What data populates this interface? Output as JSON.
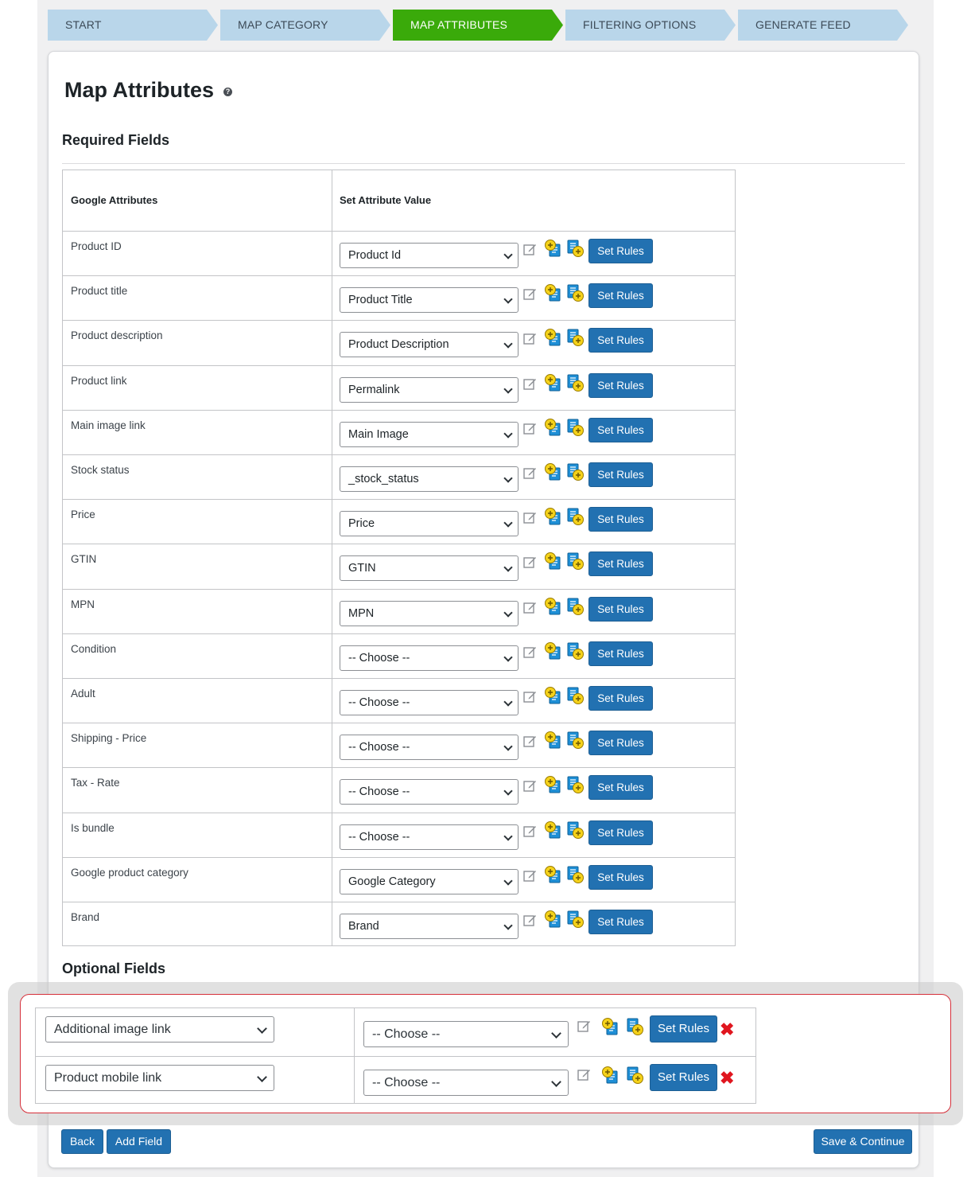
{
  "wizard": {
    "steps": [
      {
        "label": "START",
        "active": false
      },
      {
        "label": "MAP CATEGORY",
        "active": false
      },
      {
        "label": "MAP ATTRIBUTES",
        "active": true
      },
      {
        "label": "FILTERING OPTIONS",
        "active": false
      },
      {
        "label": "GENERATE FEED",
        "active": false
      }
    ]
  },
  "page": {
    "title": "Map Attributes",
    "help_icon": "question-icon"
  },
  "required": {
    "section_title": "Required Fields",
    "col_google": "Google Attributes",
    "col_value": "Set Attribute Value",
    "set_rules_label": "Set Rules",
    "rows": [
      {
        "attribute": "Product ID",
        "value": "Product Id"
      },
      {
        "attribute": "Product title",
        "value": "Product Title"
      },
      {
        "attribute": "Product description",
        "value": "Product Description"
      },
      {
        "attribute": "Product link",
        "value": "Permalink"
      },
      {
        "attribute": "Main image link",
        "value": "Main Image"
      },
      {
        "attribute": "Stock status",
        "value": "_stock_status"
      },
      {
        "attribute": "Price",
        "value": "Price"
      },
      {
        "attribute": "GTIN",
        "value": "GTIN"
      },
      {
        "attribute": "MPN",
        "value": "MPN"
      },
      {
        "attribute": "Condition",
        "value": "-- Choose --"
      },
      {
        "attribute": "Adult",
        "value": "-- Choose --"
      },
      {
        "attribute": "Shipping - Price",
        "value": "-- Choose --"
      },
      {
        "attribute": "Tax - Rate",
        "value": "-- Choose --"
      },
      {
        "attribute": "Is bundle",
        "value": "-- Choose --"
      },
      {
        "attribute": "Google product category",
        "value": "Google Category"
      },
      {
        "attribute": "Brand",
        "value": "Brand"
      }
    ]
  },
  "optional": {
    "section_title": "Optional Fields",
    "set_rules_label": "Set Rules",
    "rows": [
      {
        "attribute": "Additional image link",
        "value": "-- Choose --"
      },
      {
        "attribute": "Product mobile link",
        "value": "-- Choose --"
      }
    ]
  },
  "footer": {
    "back_label": "Back",
    "add_field_label": "Add Field",
    "save_label": "Save & Continue"
  },
  "colors": {
    "active_step": "#3aaa0a",
    "inactive_step": "#b9d6ea",
    "primary_button": "#2271b1",
    "highlight_border": "#d6303a",
    "delete_icon": "#e0161f"
  }
}
